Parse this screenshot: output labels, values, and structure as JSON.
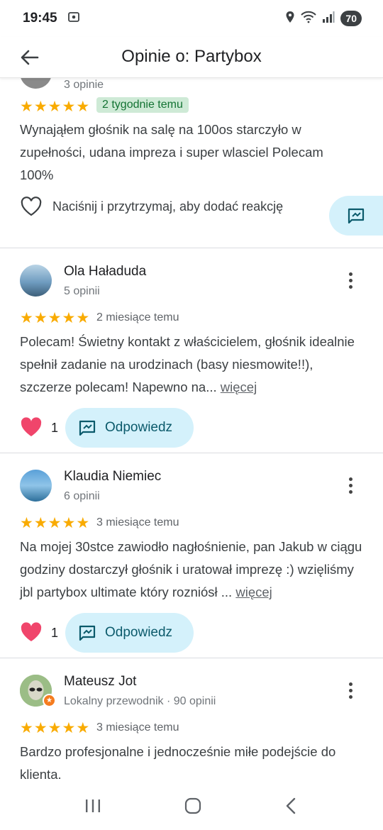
{
  "status_bar": {
    "time": "19:45",
    "battery": "70"
  },
  "header": {
    "title": "Opinie o: Partybox"
  },
  "reviews": [
    {
      "sub": "3 opinie",
      "time": "2 tygodnie temu",
      "text": "Wynająłem głośnik na salę na 100os starczyło w zupełności, udana impreza i super wlasciel Polecam 100%",
      "react_prompt": "Naciśnij i przytrzymaj, aby dodać reakcję"
    },
    {
      "name": "Ola Haładuda",
      "sub": "5 opinii",
      "time": "2 miesiące temu",
      "text": "Polecam! Świetny kontakt z właścicielem, głośnik idealnie spełnił zadanie na urodzinach (basy niesmowite!!), szczerze polecam! Napewno na...",
      "more": "więcej",
      "likes": "1",
      "reply": "Odpowiedz"
    },
    {
      "name": "Klaudia Niemiec",
      "sub": "6 opinii",
      "time": "3 miesiące temu",
      "text": "Na mojej 30stce zawiodło nagłośnienie, pan Jakub w ciągu godziny dostarczył głośnik i uratował imprezę :) wzięliśmy jbl partybox ultimate który rozniósł ...",
      "more": "więcej",
      "likes": "1",
      "reply": "Odpowiedz"
    },
    {
      "name": "Mateusz Jot",
      "sub": "Lokalny przewodnik · 90 opinii",
      "time": "3 miesiące temu",
      "text": "Bardzo profesjonalne i jednocześnie miłe podejście do klienta."
    }
  ],
  "colors": {
    "star": "#f9ab00",
    "reply_bg": "#d4f1fb",
    "badge_bg": "#ceead6",
    "heart": "#e8345a"
  }
}
